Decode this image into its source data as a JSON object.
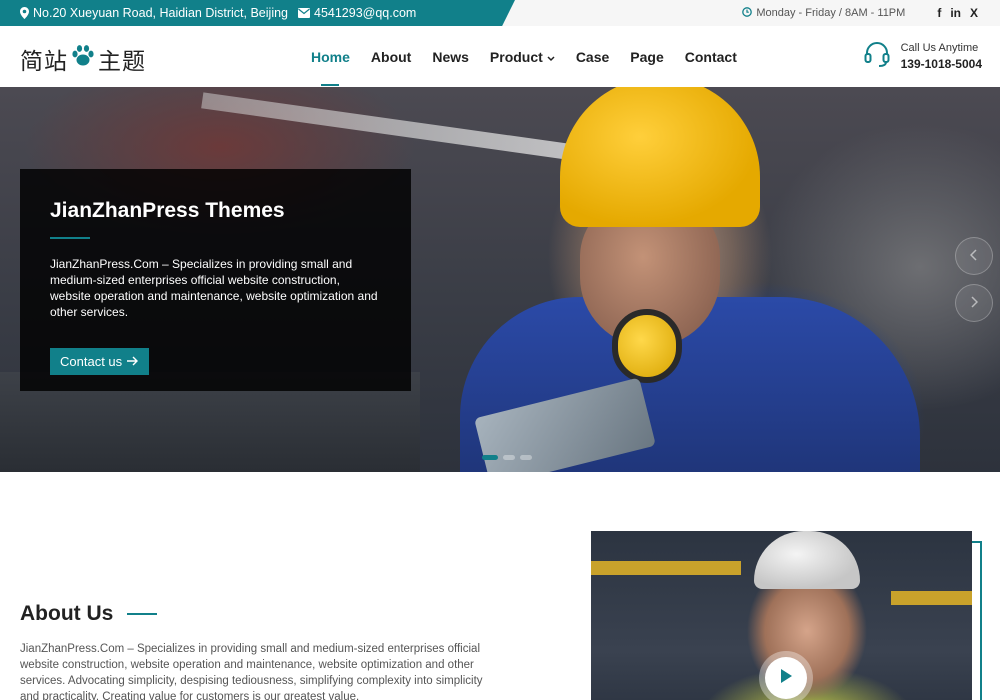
{
  "topbar": {
    "address": "No.20 Xueyuan Road, Haidian District, Beijing",
    "email": "4541293@qq.com",
    "hours": "Monday - Friday / 8AM - 11PM",
    "social": [
      "f",
      "in",
      "X"
    ]
  },
  "header": {
    "logo_left": "简站",
    "logo_right": "主题",
    "nav": [
      {
        "label": "Home",
        "active": true
      },
      {
        "label": "About"
      },
      {
        "label": "News"
      },
      {
        "label": "Product",
        "dropdown": true
      },
      {
        "label": "Case"
      },
      {
        "label": "Page"
      },
      {
        "label": "Contact"
      }
    ],
    "call_label": "Call Us Anytime",
    "call_number": "139-1018-5004"
  },
  "hero": {
    "title": "JianZhanPress Themes",
    "description": "JianZhanPress.Com – Specializes in providing small and medium-sized enterprises official website construction, website operation and maintenance, website optimization and other services.",
    "button_label": "Contact us",
    "slide_count": 3,
    "active_slide": 0
  },
  "about": {
    "title": "About Us",
    "text": "JianZhanPress.Com – Specializes in providing small and medium-sized enterprises official website construction, website operation and maintenance, website optimization and other services. Advocating simplicity, despising tediousness, simplifying complexity into simplicity and practicality. Creating value for customers is our greatest value."
  },
  "colors": {
    "accent": "#11808a"
  }
}
